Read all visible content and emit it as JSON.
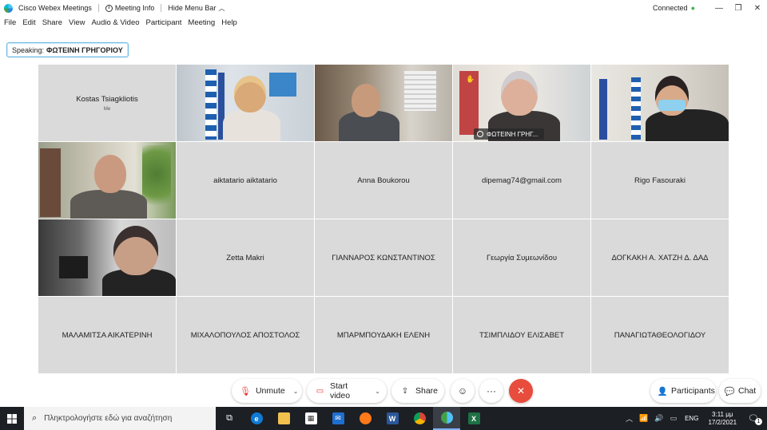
{
  "titlebar": {
    "app_name": "Cisco Webex Meetings",
    "meeting_info": "Meeting Info",
    "hide_menu": "Hide Menu Bar",
    "status": "Connected"
  },
  "menu": [
    "File",
    "Edit",
    "Share",
    "View",
    "Audio & Video",
    "Participant",
    "Meeting",
    "Help"
  ],
  "speaking": {
    "label": "Speaking:",
    "name": "ΦΩΤΕΙΝΗ ΓΡΗΓΟΡΙΟΥ"
  },
  "tiles": [
    {
      "name": "Kostas Tsiagkliotis",
      "sub": "Me"
    },
    {
      "name": ""
    },
    {
      "name": ""
    },
    {
      "name": "ΦΩΤΕΙΝΗ ΓΡΗΓ..."
    },
    {
      "name": ""
    },
    {
      "name": ""
    },
    {
      "name": "aiktatario aiktatario"
    },
    {
      "name": "Anna Boukorou"
    },
    {
      "name": "dipemag74@gmail.com"
    },
    {
      "name": "Rigo Fasouraki"
    },
    {
      "name": ""
    },
    {
      "name": "Zetta Makri"
    },
    {
      "name": "ΓΙΑΝΝΑΡΟΣ ΚΩΝΣΤΑΝΤΙΝΟΣ"
    },
    {
      "name": "Γεωργία Συμεωνίδου"
    },
    {
      "name": "ΔΟΓΚΑΚΗ Α. ΧΑΤΖΗ Δ. ΔΑΔ"
    },
    {
      "name": "ΜΑΛΑΜΙΤΣΑ ΑΙΚΑΤΕΡΙΝΗ"
    },
    {
      "name": "ΜΙΧΑΛΟΠΟΥΛΟΣ ΑΠΟΣΤΟΛΟΣ"
    },
    {
      "name": "ΜΠΑΡΜΠΟΥΔΑΚΗ ΕΛΕΝΗ"
    },
    {
      "name": "ΤΣΙΜΠΛΙΔΟΥ ΕΛΙΣΑΒΕΤ"
    },
    {
      "name": "ΠΑΝΑΓΙΩΤΑΘΕΟΛΟΓΙΔΟΥ"
    }
  ],
  "controls": {
    "unmute": "Unmute",
    "start_video": "Start video",
    "share": "Share",
    "more": "···",
    "end": "✕",
    "participants": "Participants",
    "chat": "Chat"
  },
  "taskbar": {
    "search_placeholder": "Πληκτρολογήστε εδώ για αναζήτηση",
    "lang": "ENG",
    "time": "3:11 μμ",
    "date": "17/2/2021",
    "notifications": "1"
  },
  "colors": {
    "accent": "#29b6f6",
    "end_call": "#e74c3c",
    "connected": "#3bb54a",
    "taskbar": "#1c1f24"
  }
}
